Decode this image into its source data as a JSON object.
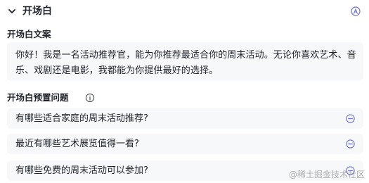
{
  "section": {
    "title": "开场白",
    "collapse_icon": "chevron-down-icon",
    "ai_icon": "ai-assist-icon"
  },
  "opening_text": {
    "label": "开场白文案",
    "value_line1": "你好！我是一名活动推荐官，能为你推荐最适合你的周末活动。无论你喜欢艺术、音",
    "value_line2": "乐、戏剧还是电影，我都能为你提供最好的选择。"
  },
  "preset_questions": {
    "label": "开场白预置问题",
    "info_icon": "info-icon",
    "remove_icon": "minus-circle-icon",
    "items": [
      {
        "text": "有哪些适合家庭的周末活动推荐?"
      },
      {
        "text": "最近有哪些艺术展览值得一看?"
      },
      {
        "text": "有哪些免费的周末活动可以参加?"
      }
    ]
  },
  "watermark": "@稀土掘金技术社区",
  "colors": {
    "accent": "#6b6fd8",
    "field_background": "#f7f8fa",
    "text_primary": "#1f2329"
  }
}
